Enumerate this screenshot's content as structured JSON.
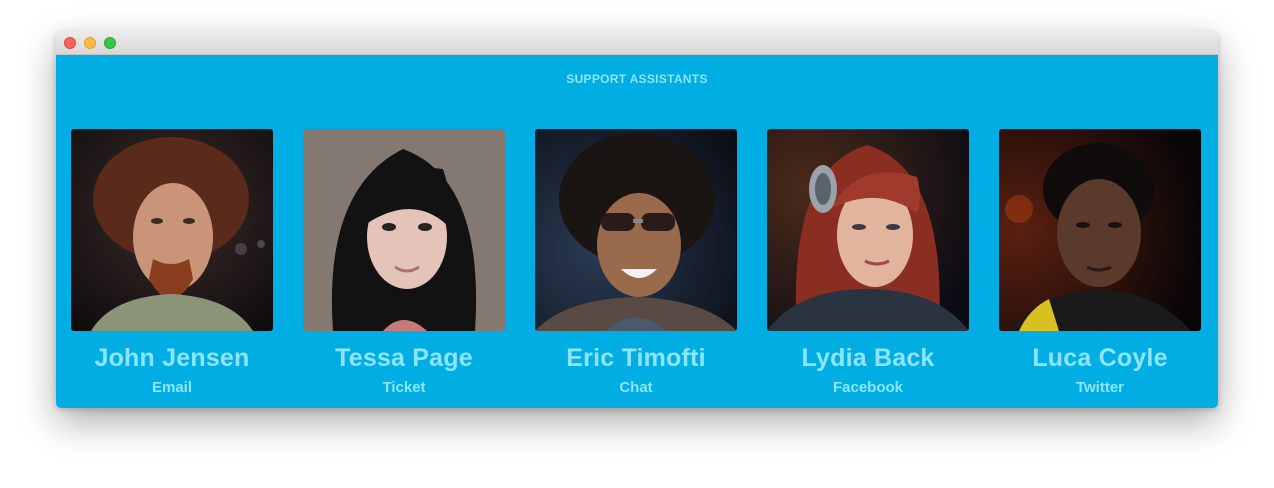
{
  "window": {
    "controls": [
      "close-icon",
      "minimize-icon",
      "maximize-icon"
    ]
  },
  "section": {
    "title": "SUPPORT ASSISTANTS"
  },
  "assistants": [
    {
      "name": "John Jensen",
      "channel": "Email"
    },
    {
      "name": "Tessa Page",
      "channel": "Ticket"
    },
    {
      "name": "Eric Timofti",
      "channel": "Chat"
    },
    {
      "name": "Lydia Back",
      "channel": "Facebook"
    },
    {
      "name": "Luca Coyle",
      "channel": "Twitter"
    }
  ],
  "colors": {
    "background": "#00aee3",
    "text": "#8ee5fb"
  }
}
